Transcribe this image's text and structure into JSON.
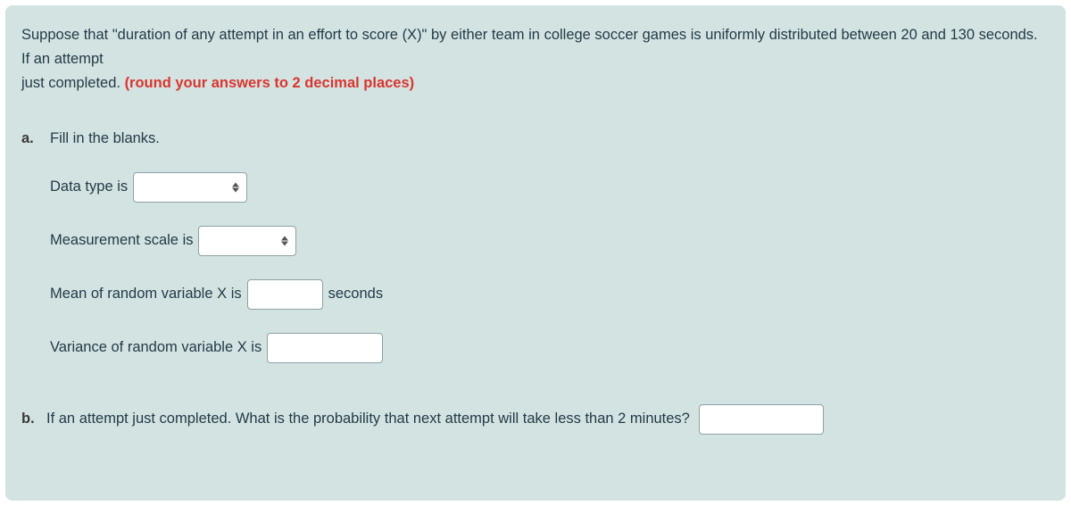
{
  "intro": {
    "line1": "Suppose that \"duration of any attempt in an effort to score (X)\" by either team in college soccer games is uniformly distributed between 20 and 130 seconds. If an attempt",
    "line2_prefix": "just completed.  ",
    "line2_note": "(round your answers to 2 decimal places)"
  },
  "qa": {
    "label": "a.",
    "title": "Fill in the blanks.",
    "row1_prefix": "Data type is",
    "row2_prefix": "Measurement scale is",
    "row3_prefix": "Mean of random variable X is",
    "row3_suffix": "seconds",
    "row4_prefix": "Variance of random variable X is"
  },
  "qb": {
    "label": "b.",
    "text": "If an attempt just completed. What is the probability that next attempt will take less than 2 minutes?"
  }
}
